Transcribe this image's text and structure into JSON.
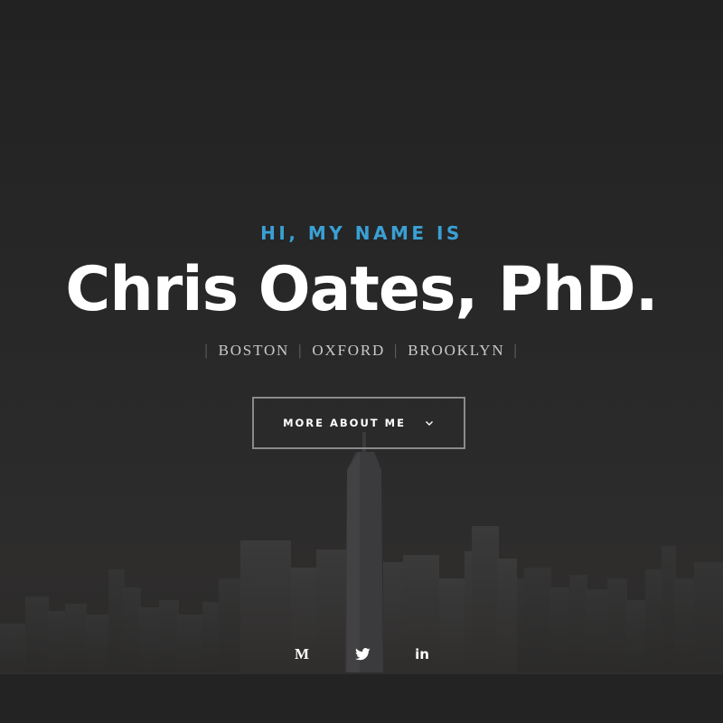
{
  "hero": {
    "greeting": "HI, MY NAME IS",
    "name": "Chris Oates, PhD.",
    "locations": [
      "BOSTON",
      "OXFORD",
      "BROOKLYN"
    ],
    "separator": "|",
    "cta_label": "MORE ABOUT ME",
    "cta_icon": "chevron-down-icon",
    "background": "city-skyline-at-dusk"
  },
  "socials": [
    {
      "name": "medium",
      "glyph": "M",
      "icon": "medium-icon"
    },
    {
      "name": "twitter",
      "glyph": "",
      "icon": "twitter-icon"
    },
    {
      "name": "linkedin",
      "glyph": "in",
      "icon": "linkedin-icon"
    }
  ],
  "colors": {
    "accent": "#3aa0d4",
    "background": "#262626",
    "text": "#ffffff",
    "subtext": "#c9c9c9",
    "button_border": "#8a8a8a"
  }
}
